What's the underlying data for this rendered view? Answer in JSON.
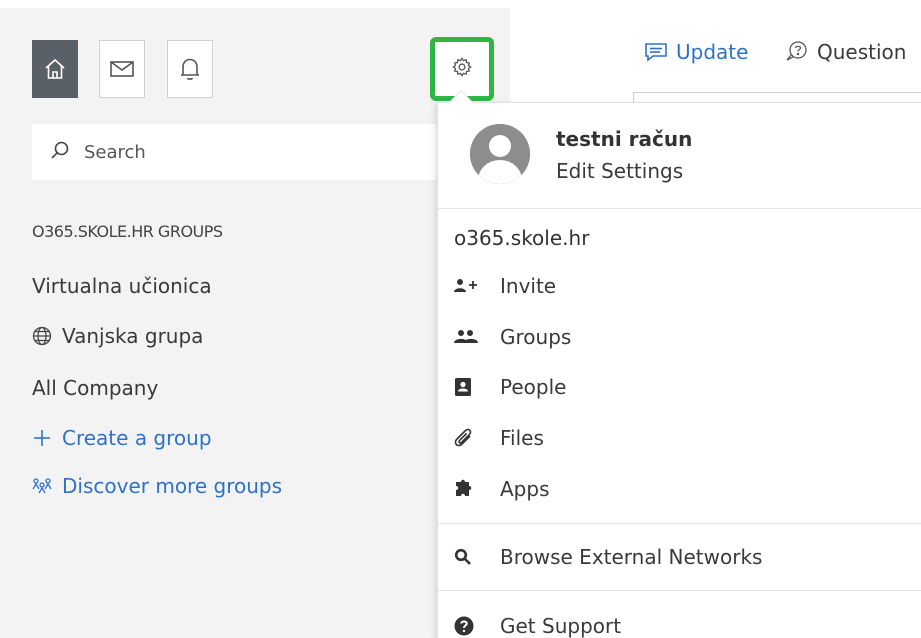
{
  "nav": {
    "home_icon": "home-icon",
    "inbox_icon": "mail-icon",
    "notifications_icon": "bell-icon",
    "settings_icon": "gear-icon"
  },
  "search": {
    "placeholder": "Search"
  },
  "groups": {
    "header": "O365.SKOLE.HR GROUPS",
    "items": [
      {
        "label": "Virtualna učionica"
      },
      {
        "label": "Vanjska grupa",
        "icon": "globe-icon"
      },
      {
        "label": "All Company"
      }
    ],
    "create": {
      "label": "Create a group",
      "icon": "plus-icon"
    },
    "discover": {
      "label": "Discover more groups",
      "icon": "people-network-icon"
    }
  },
  "tabs": [
    {
      "label": "Update",
      "icon": "chat-icon"
    },
    {
      "label": "Question",
      "icon": "question-bubble-icon"
    }
  ],
  "dropdown": {
    "profile": {
      "name": "testni račun",
      "edit_label": "Edit Settings"
    },
    "network": "o365.skole.hr",
    "menu": [
      {
        "label": "Invite",
        "icon": "add-user-icon"
      },
      {
        "label": "Groups",
        "icon": "group-icon"
      },
      {
        "label": "People",
        "icon": "contact-card-icon"
      },
      {
        "label": "Files",
        "icon": "paperclip-icon"
      },
      {
        "label": "Apps",
        "icon": "puzzle-icon"
      }
    ],
    "browse": {
      "label": "Browse External Networks",
      "icon": "search-icon"
    },
    "support": {
      "label": "Get Support",
      "icon": "question-circle-icon"
    }
  },
  "colors": {
    "highlight": "#2fb545",
    "link": "#2e72c8",
    "active_nav": "#5a6068"
  }
}
